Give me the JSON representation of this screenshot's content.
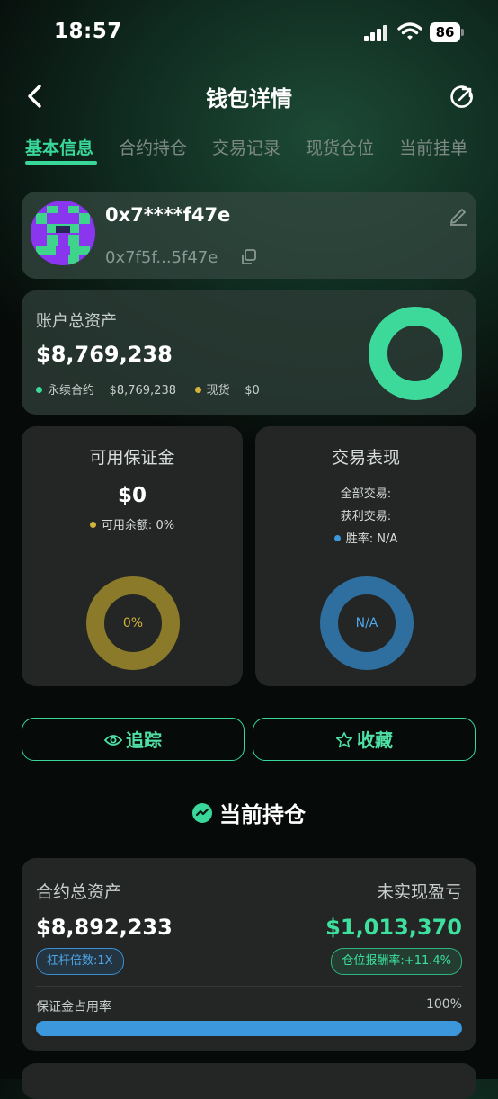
{
  "status_bar": {
    "time": "18:57",
    "battery": "86"
  },
  "header": {
    "title": "钱包详情"
  },
  "tabs": [
    {
      "label": "基本信息",
      "active": true
    },
    {
      "label": "合约持仓",
      "active": false
    },
    {
      "label": "交易记录",
      "active": false
    },
    {
      "label": "现货仓位",
      "active": false
    },
    {
      "label": "当前挂单",
      "active": false
    }
  ],
  "profile": {
    "name": "0x7****f47e",
    "address": "0x7f5f...5f47e"
  },
  "total_assets": {
    "label": "账户总资产",
    "value": "$8,769,238",
    "legend": [
      {
        "name": "永续合约",
        "value": "$8,769,238",
        "color": "#3dd99a"
      },
      {
        "name": "现货",
        "value": "$0",
        "color": "#d4b338"
      }
    ]
  },
  "margin": {
    "title": "可用保证金",
    "value": "$0",
    "sub_label": "可用余额:",
    "sub_value": "0%",
    "ring_label": "0%",
    "color": "#8a7a2a"
  },
  "performance": {
    "title": "交易表现",
    "all_trades": "全部交易:",
    "profit_trades": "获利交易:",
    "win_rate_label": "胜率:",
    "win_rate_value": "N/A",
    "ring_label": "N/A",
    "color": "#2e6fa0"
  },
  "actions": {
    "track": "追踪",
    "favorite": "收藏"
  },
  "positions": {
    "section_title": "当前持仓",
    "contract_assets_label": "合约总资产",
    "contract_assets_value": "$8,892,233",
    "unrealized_label": "未实现盈亏",
    "unrealized_value": "$1,013,370",
    "leverage": "杠杆倍数:1X",
    "roi": "仓位报酬率:+11.4%",
    "margin_usage_label": "保证金占用率",
    "margin_usage_pct": "100%",
    "margin_usage_value": 1.0
  },
  "colors": {
    "accent": "#39d89a",
    "blue": "#3d97dd"
  }
}
